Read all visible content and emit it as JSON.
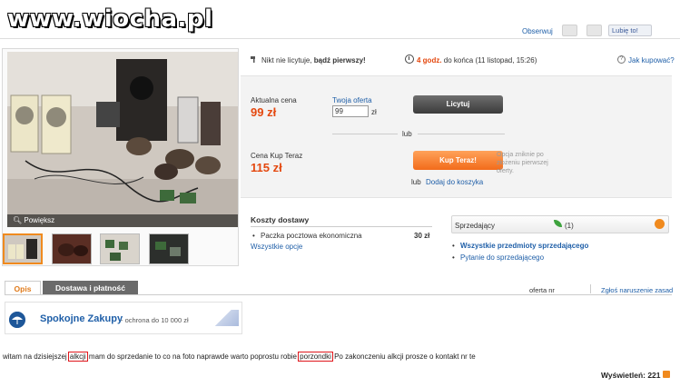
{
  "watermark": "www.wiocha.pl",
  "header": {
    "obserwuj": "Obserwuj",
    "lubie": "Lubię to!"
  },
  "gallery": {
    "powieksz": "Powiększ",
    "thumb_count": 4
  },
  "auction": {
    "no_bids": "Nikt nie licytuje, ",
    "be_first": "bądź pierwszy!",
    "time_left": "4 godz.",
    "time_suffix": " do końca (11 listopad, 15:26)",
    "help_link": "Jak kupować?",
    "current_price_label": "Aktualna cena",
    "current_price": "99 zł",
    "your_offer_label": "Twoja oferta",
    "offer_value": "99",
    "offer_currency": "zł",
    "bid_button": "Licytuj",
    "or": "lub",
    "buy_now_label": "Cena Kup Teraz",
    "buy_now_price": "115 zł",
    "buy_now_button": "Kup Teraz!",
    "buy_now_note": "Opcja zniknie po złożeniu pierwszej oferty.",
    "or2": "lub",
    "add_to_cart": "Dodaj do koszyka"
  },
  "shipping": {
    "title": "Koszty dostawy",
    "method": "Paczka pocztowa ekonomiczna",
    "price": "30 zł",
    "all_options": "Wszystkie opcje"
  },
  "seller": {
    "label": "Sprzedający",
    "rating": "(1)",
    "all_items": "Wszystkie przedmioty sprzedającego",
    "ask": "Pytanie do sprzedającego"
  },
  "tabs": {
    "opis": "Opis",
    "dostawa": "Dostawa i płatność",
    "oferta_nr": "oferta nr",
    "zglos": "Zgłoś naruszenie zasad"
  },
  "safe": {
    "title": "Spokojne Zakupy",
    "sub": "- ochrona do 10 000 zł"
  },
  "description": {
    "p1": "witam na dzisiejszej ",
    "h1": "alkcji",
    "p2": " mam do sprzedanie to co na foto naprawde warto poprostu robie ",
    "h2": "porzondki",
    "p3": " Po zakonczeniu alkcji prosze o kontakt nr te"
  },
  "views": {
    "label": "Wyświetleń: 221"
  }
}
